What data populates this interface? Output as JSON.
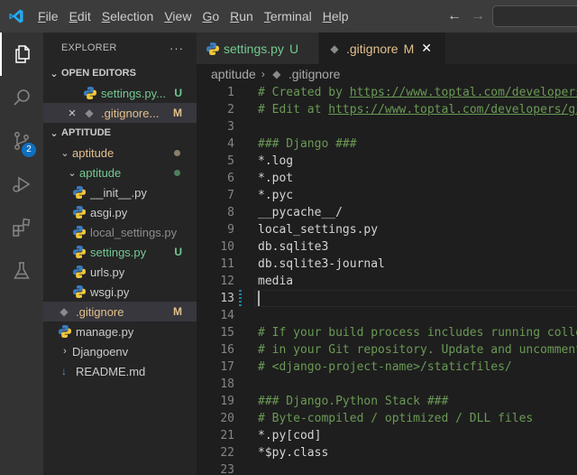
{
  "menu": {
    "items": [
      {
        "pre": "",
        "u": "F",
        "post": "ile"
      },
      {
        "pre": "",
        "u": "E",
        "post": "dit"
      },
      {
        "pre": "",
        "u": "S",
        "post": "election"
      },
      {
        "pre": "",
        "u": "V",
        "post": "iew"
      },
      {
        "pre": "",
        "u": "G",
        "post": "o"
      },
      {
        "pre": "",
        "u": "R",
        "post": "un"
      },
      {
        "pre": "",
        "u": "T",
        "post": "erminal"
      },
      {
        "pre": "",
        "u": "H",
        "post": "elp"
      }
    ]
  },
  "activity": {
    "scm_badge": "2"
  },
  "sidebar": {
    "title": "EXPLORER",
    "more": "···",
    "open_editors": {
      "header": "OPEN EDITORS",
      "items": [
        {
          "name": "settings.py...",
          "status": "U",
          "close": ""
        },
        {
          "name": ".gitignore...",
          "status": "M",
          "close": "×"
        }
      ]
    },
    "workspace": {
      "header": "APTITUDE",
      "tree": [
        {
          "name": "aptitude",
          "kind": "folder-open"
        },
        {
          "name": "aptitude",
          "kind": "folder-open"
        },
        {
          "name": "__init__.py",
          "kind": "py"
        },
        {
          "name": "asgi.py",
          "kind": "py"
        },
        {
          "name": "local_settings.py",
          "kind": "py"
        },
        {
          "name": "settings.py",
          "kind": "py",
          "status": "U"
        },
        {
          "name": "urls.py",
          "kind": "py"
        },
        {
          "name": "wsgi.py",
          "kind": "py"
        },
        {
          "name": ".gitignore",
          "kind": "git",
          "status": "M"
        },
        {
          "name": "manage.py",
          "kind": "py"
        },
        {
          "name": "Djangoenv",
          "kind": "folder-closed"
        },
        {
          "name": "README.md",
          "kind": "md"
        }
      ]
    }
  },
  "tabs": [
    {
      "name": "settings.py",
      "status": "U"
    },
    {
      "name": ".gitignore",
      "status": "M",
      "close": "✕"
    }
  ],
  "breadcrumb": {
    "folder": "aptitude",
    "file": ".gitignore"
  },
  "editor": {
    "lines": [
      {
        "n": "1",
        "parts": [
          {
            "t": "# Created by ",
            "c": "cmt"
          },
          {
            "t": "https://www.toptal.com/developers",
            "c": "cmt link"
          }
        ]
      },
      {
        "n": "2",
        "parts": [
          {
            "t": "# Edit at ",
            "c": "cmt"
          },
          {
            "t": "https://www.toptal.com/developers/gi",
            "c": "cmt link"
          }
        ]
      },
      {
        "n": "3",
        "parts": []
      },
      {
        "n": "4",
        "parts": [
          {
            "t": "### Django ###",
            "c": "cmt"
          }
        ]
      },
      {
        "n": "5",
        "parts": [
          {
            "t": "*.log",
            "c": ""
          }
        ]
      },
      {
        "n": "6",
        "parts": [
          {
            "t": "*.pot",
            "c": ""
          }
        ]
      },
      {
        "n": "7",
        "parts": [
          {
            "t": "*.pyc",
            "c": ""
          }
        ]
      },
      {
        "n": "8",
        "parts": [
          {
            "t": "__pycache__/",
            "c": ""
          }
        ]
      },
      {
        "n": "9",
        "parts": [
          {
            "t": "local_settings.py",
            "c": ""
          }
        ]
      },
      {
        "n": "10",
        "parts": [
          {
            "t": "db.sqlite3",
            "c": ""
          }
        ]
      },
      {
        "n": "11",
        "parts": [
          {
            "t": "db.sqlite3-journal",
            "c": ""
          }
        ]
      },
      {
        "n": "12",
        "parts": [
          {
            "t": "media",
            "c": ""
          }
        ]
      },
      {
        "n": "13",
        "parts": []
      },
      {
        "n": "14",
        "parts": []
      },
      {
        "n": "15",
        "parts": [
          {
            "t": "# If your build process includes running colle",
            "c": "cmt"
          }
        ]
      },
      {
        "n": "16",
        "parts": [
          {
            "t": "# in your Git repository. Update and uncomment",
            "c": "cmt"
          }
        ]
      },
      {
        "n": "17",
        "parts": [
          {
            "t": "# <django-project-name>/staticfiles/",
            "c": "cmt"
          }
        ]
      },
      {
        "n": "18",
        "parts": []
      },
      {
        "n": "19",
        "parts": [
          {
            "t": "### Django.Python Stack ###",
            "c": "cmt"
          }
        ]
      },
      {
        "n": "20",
        "parts": [
          {
            "t": "# Byte-compiled / optimized / DLL files",
            "c": "cmt"
          }
        ]
      },
      {
        "n": "21",
        "parts": [
          {
            "t": "*.py[cod]",
            "c": ""
          }
        ]
      },
      {
        "n": "22",
        "parts": [
          {
            "t": "*$py.class",
            "c": ""
          }
        ]
      },
      {
        "n": "23",
        "parts": []
      }
    ],
    "current_line": "13"
  },
  "colors": {
    "accent": "#0e70c0",
    "untracked": "#73c991",
    "modified": "#e2c08d",
    "comment": "#6a9955"
  }
}
